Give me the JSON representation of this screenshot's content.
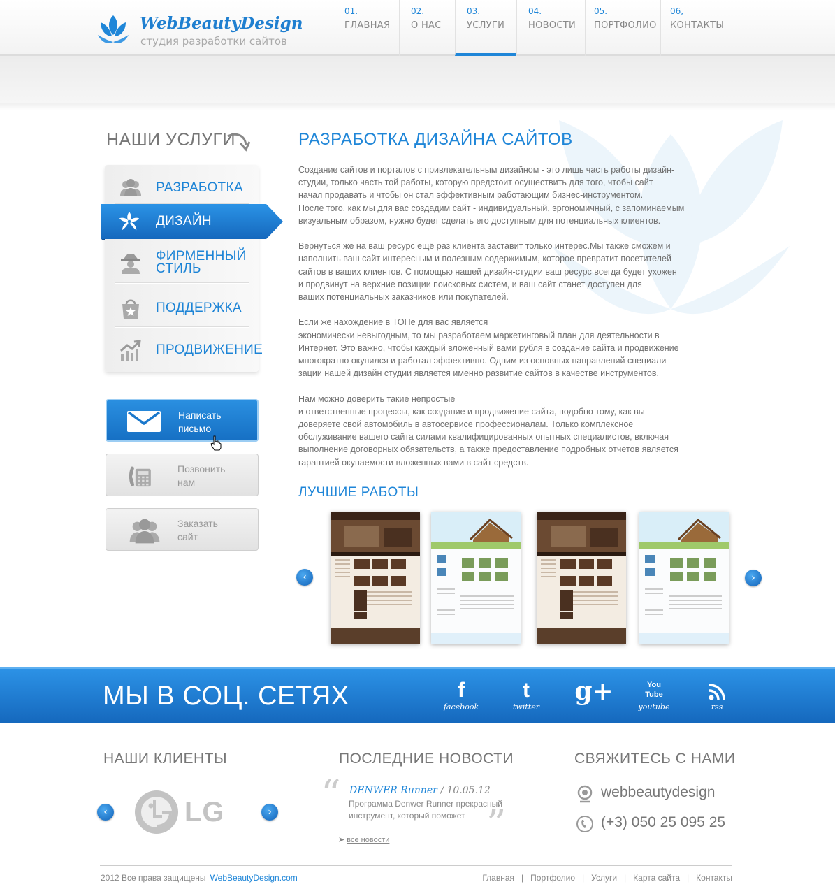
{
  "brand": {
    "title": "WebBeautyDesign",
    "subtitle": "студия разработки сайтов"
  },
  "colors": {
    "accent": "#1f86d8",
    "accent_dark": "#1568bd",
    "text": "#707070",
    "muted": "#999999"
  },
  "nav": [
    {
      "num": "01.",
      "label": "ГЛАВНАЯ"
    },
    {
      "num": "02.",
      "label": "О НАС"
    },
    {
      "num": "03.",
      "label": "УСЛУГИ",
      "active": true
    },
    {
      "num": "04.",
      "label": "НОВОСТИ"
    },
    {
      "num": "05.",
      "label": "ПОРТФОЛИО"
    },
    {
      "num": "06,",
      "label": "КОНТАКТЫ"
    }
  ],
  "sidebar": {
    "heading": "НАШИ УСЛУГИ",
    "items": [
      {
        "label": "РАЗРАБОТКА",
        "icon": "users-icon"
      },
      {
        "label": "ДИЗАЙН",
        "icon": "flower-icon",
        "active": true
      },
      {
        "label": "ФИРМЕННЫЙ",
        "label2": "СТИЛЬ",
        "icon": "agent-icon"
      },
      {
        "label": "ПОДДЕРЖКА",
        "icon": "shopping-bag-icon"
      },
      {
        "label": "ПРОДВИЖЕНИЕ",
        "icon": "growth-chart-icon"
      }
    ],
    "cta": [
      {
        "line1": "Написать",
        "line2": "письмо",
        "icon": "envelope-icon"
      },
      {
        "line1": "Позвонить",
        "line2": "нам",
        "icon": "phone-icon"
      },
      {
        "line1": "Заказать",
        "line2": "сайт",
        "icon": "users-icon"
      }
    ]
  },
  "main": {
    "title": "РАЗРАБОТКА ДИЗАЙНА САЙТОВ",
    "paragraphs": [
      "Создание сайтов и порталов с привлекательным дизайном - это лишь часть работы дизайн-",
      "студии, только часть той работы, которую предстоит осуществить для того, чтобы сайт",
      "начал продавать и чтобы он стал эффективным работающим бизнес-инструментом.",
      "После того, как мы для вас создадим сайт - индивидуальный, эргономичный, с запоминаемым",
      " визуальным образом, нужно будет сделать его доступным для потенциальных клиентов.",
      "",
      "Вернуться же на ваш ресурс ещё раз клиента заставит только интерес.Мы также сможем и",
      "наполнить ваш сайт интересным и полезным содержимым, которое превратит посетителей",
      "сайтов в ваших клиентов. С помощью нашей дизайн-студии ваш ресурс всегда будет ухожен",
      "и продвинут на верхние позиции поисковых систем, и ваш сайт станет доступен для",
      "ваших потенциальных заказчиков или покупателей.",
      "",
      "Если же нахождение в ТОПе для вас является",
      "экономически невыгодным, то мы разработаем маркетинговый план для деятельности в",
      "Интернет. Это важно, чтобы каждый вложенный вами рубля в создание сайта и продвижение",
      "многократно окупился и работал эффективно. Одним из основных направлений специали-",
      "зации нашей дизайн студии является именно развитие сайтов в качестве инструментов.",
      "",
      "Нам можно доверить такие непростые",
      "и ответственные процессы, как создание и продвижение сайта, подобно тому, как вы",
      "доверяете свой автомобиль в автосервисе профессионалам. Только комплексное",
      "обслуживание вашего сайта силами квалифицированных опытных специалистов, включая",
      "выполнение договорных обязательств, а также предоставление подробных отчетов является",
      "гарантией окупаемости вложенных вами в сайт средств."
    ],
    "works_title": "ЛУЧШИЕ РАБОТЫ"
  },
  "social": {
    "title": "МЫ В СОЦ. СЕТЯХ",
    "items": [
      {
        "glyph": "f",
        "label": "facebook"
      },
      {
        "glyph": "t",
        "label": "twitter"
      },
      {
        "glyph": "g+",
        "label": ""
      },
      {
        "glyph": "You Tube",
        "label": "youtube"
      },
      {
        "glyph": "rss",
        "label": "rss"
      }
    ]
  },
  "footer": {
    "clients_title": "НАШИ КЛИЕНТЫ",
    "client_logo_text": "LG",
    "news_title": "ПОСЛЕДНИЕ НОВОСТИ",
    "news": {
      "title": "DENWER Runner",
      "date": "/ 10.05.12",
      "text": "Программа Denwer Runner прекрасный инструмент, который поможет",
      "all_arrow": "➤",
      "all": "все новости"
    },
    "contact_title": "СВЯЖИТЕСЬ  С НАМИ",
    "skype": "webbeautydesign",
    "phone": "(+3) 050 25 095 25",
    "copyright": "2012 Все права защищены",
    "site": "WebBeautyDesign.com",
    "links": [
      "Главная",
      "Портфолио",
      "Услуги",
      "Карта сайта",
      "Контакты"
    ],
    "link_sep": "|"
  }
}
